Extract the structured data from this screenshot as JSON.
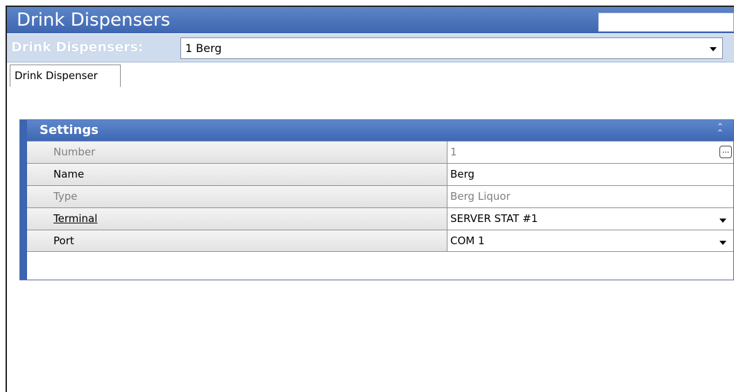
{
  "window": {
    "title": "Drink Dispensers"
  },
  "selector": {
    "label": "Drink Dispensers:",
    "value": "1 Berg"
  },
  "tabs": [
    {
      "label": "Drink Dispenser",
      "active": true
    }
  ],
  "settings": {
    "title": "Settings",
    "collapse_icon": "double-chevron-up-icon",
    "rows": [
      {
        "label": "Number",
        "value": "1",
        "editor": "ellipsis"
      },
      {
        "label": "Name",
        "value": "Berg",
        "editor": "text"
      },
      {
        "label": "Type",
        "value": "Berg Liquor",
        "editor": "readonly"
      },
      {
        "label": "Terminal",
        "value": "SERVER STAT #1",
        "editor": "dropdown"
      },
      {
        "label": "Port",
        "value": "COM 1",
        "editor": "dropdown"
      }
    ],
    "ellipsis_label": "..."
  },
  "colors": {
    "title_bar": "#3d66b0",
    "selector_bar": "#cfdcee",
    "header_accent": "#3c64b0"
  }
}
